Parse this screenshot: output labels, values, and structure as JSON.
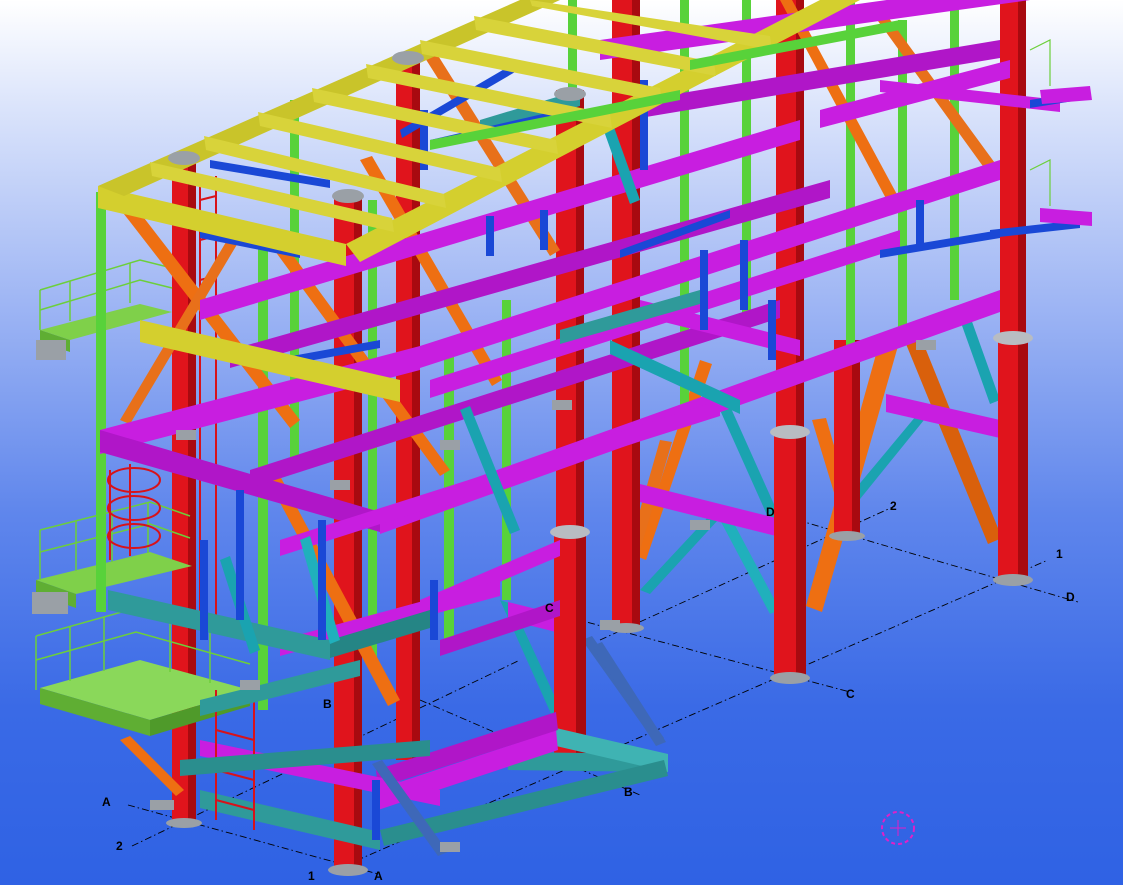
{
  "scene": {
    "description_colors": {
      "column": "#e0141c",
      "column_shadow": "#a80a10",
      "roof_beam": "#d4cf2e",
      "magenta_beam": "#c81ee0",
      "green_member": "#58d23a",
      "orange_brace": "#ee6f12",
      "blue_member": "#1a48d6",
      "cyan_member": "#1aa3b0",
      "teal_beam": "#2f9a9a",
      "grey_plate": "#9aa0a6",
      "lime_platform": "#7fd04a"
    }
  },
  "grid_labels": {
    "axis_1_far": "1",
    "axis_2_far": "2",
    "axis_D_far": "D",
    "axis_D_mid": "D",
    "axis_C_mid": "C",
    "axis_C_right": "C",
    "axis_B_mid": "B",
    "axis_B_right": "B",
    "axis_A_left": "A",
    "axis_2_left": "2",
    "axis_1_bottom": "1",
    "axis_A_bottom": "A"
  }
}
